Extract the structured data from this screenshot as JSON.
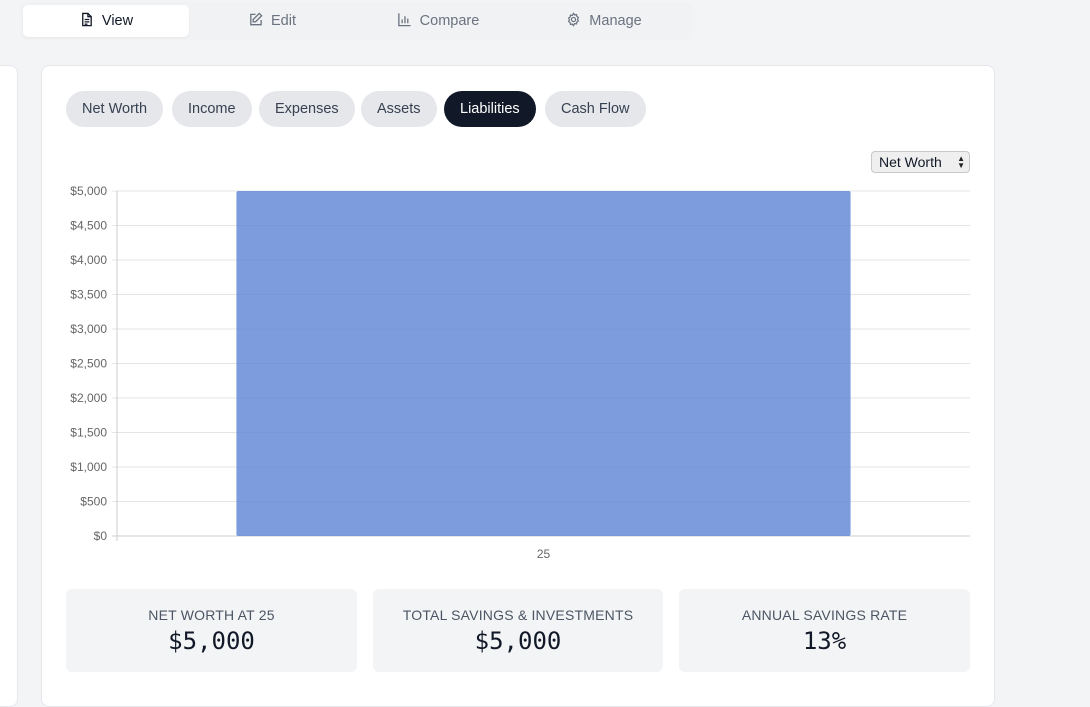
{
  "tabs": [
    {
      "label": "View",
      "icon": "document-icon",
      "active": true
    },
    {
      "label": "Edit",
      "icon": "edit-icon",
      "active": false
    },
    {
      "label": "Compare",
      "icon": "bar-chart-icon",
      "active": false
    },
    {
      "label": "Manage",
      "icon": "gear-icon",
      "active": false
    }
  ],
  "pills": [
    "Net Worth",
    "Income",
    "Expenses",
    "Assets",
    "Liabilities",
    "Cash Flow"
  ],
  "active_pill": "Liabilities",
  "chart_select": "Net Worth",
  "chart_data": {
    "type": "bar",
    "categories": [
      "25"
    ],
    "values": [
      5000
    ],
    "ylim": [
      0,
      5000
    ],
    "yticks": [
      0,
      500,
      1000,
      1500,
      2000,
      2500,
      3000,
      3500,
      4000,
      4500,
      5000
    ],
    "ytick_labels": [
      "$0",
      "$500",
      "$1,000",
      "$1,500",
      "$2,000",
      "$2,500",
      "$3,000",
      "$3,500",
      "$4,000",
      "$4,500",
      "$5,000"
    ],
    "grid": true,
    "bar_color": "#5b83d6"
  },
  "stats": [
    {
      "label": "NET WORTH AT 25",
      "value": "$5,000"
    },
    {
      "label": "TOTAL SAVINGS & INVESTMENTS",
      "value": "$5,000"
    },
    {
      "label": "ANNUAL SAVINGS RATE",
      "value": "13%"
    }
  ]
}
